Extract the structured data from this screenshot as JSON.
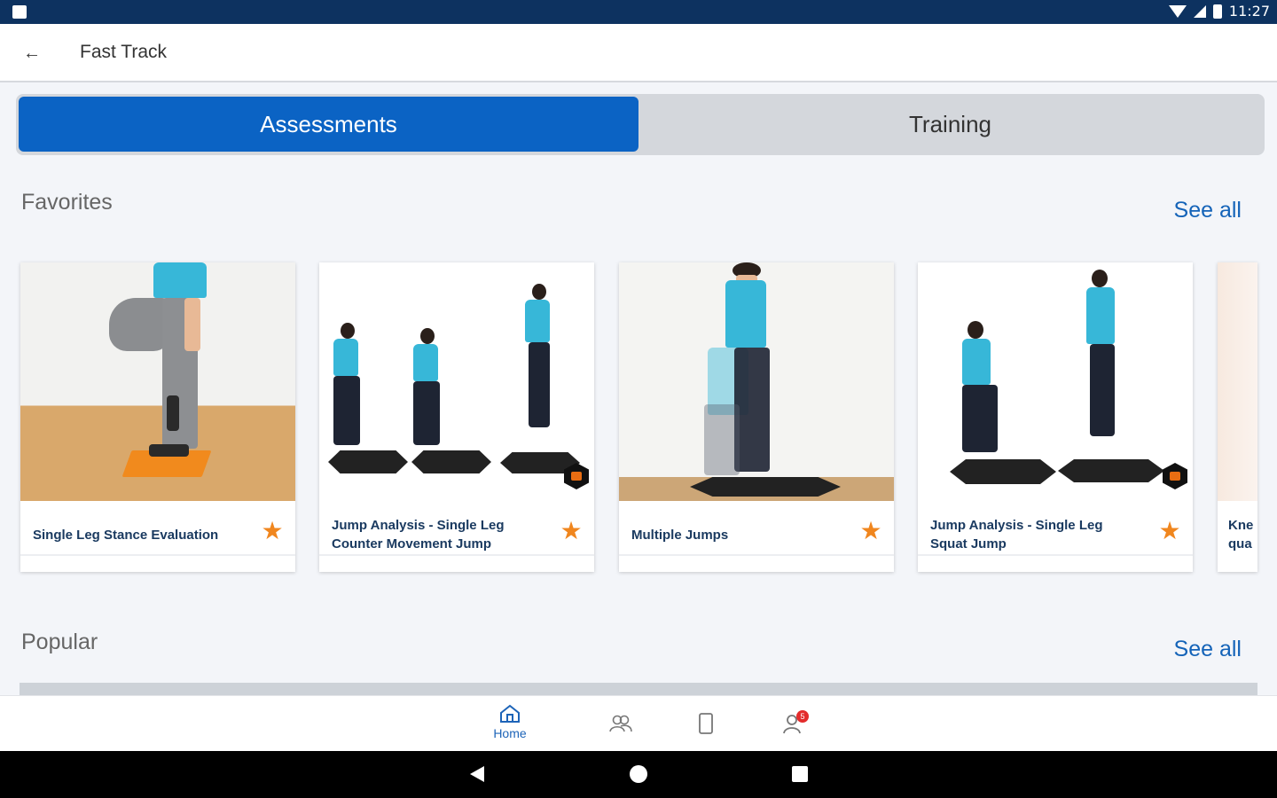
{
  "status_bar": {
    "time": "11:27"
  },
  "app_bar": {
    "title": "Fast Track"
  },
  "tabs": [
    {
      "label": "Assessments",
      "active": true
    },
    {
      "label": "Training",
      "active": false
    }
  ],
  "favorites": {
    "title": "Favorites",
    "see_all": "See all",
    "cards": [
      {
        "title": "Single Leg Stance Evaluation",
        "favorite": true
      },
      {
        "title": "Jump Analysis - Single Leg Counter Movement Jump",
        "favorite": true
      },
      {
        "title": "Multiple Jumps",
        "favorite": true
      },
      {
        "title": "Jump Analysis - Single Leg Squat Jump",
        "favorite": true
      }
    ],
    "partial_card": {
      "line1": "Kne",
      "line2": "qua"
    }
  },
  "popular": {
    "title": "Popular",
    "see_all": "See all"
  },
  "bottom_nav": {
    "home_label": "Home",
    "notification_count": "5"
  },
  "colors": {
    "primary": "#0b63c4",
    "status_bar": "#0d3260",
    "star": "#f0861e",
    "link": "#1463b8"
  },
  "icons": [
    "back-arrow-icon",
    "wifi-icon",
    "signal-icon",
    "battery-icon",
    "star-icon",
    "home-icon",
    "people-icon",
    "phone-icon",
    "profile-icon"
  ]
}
